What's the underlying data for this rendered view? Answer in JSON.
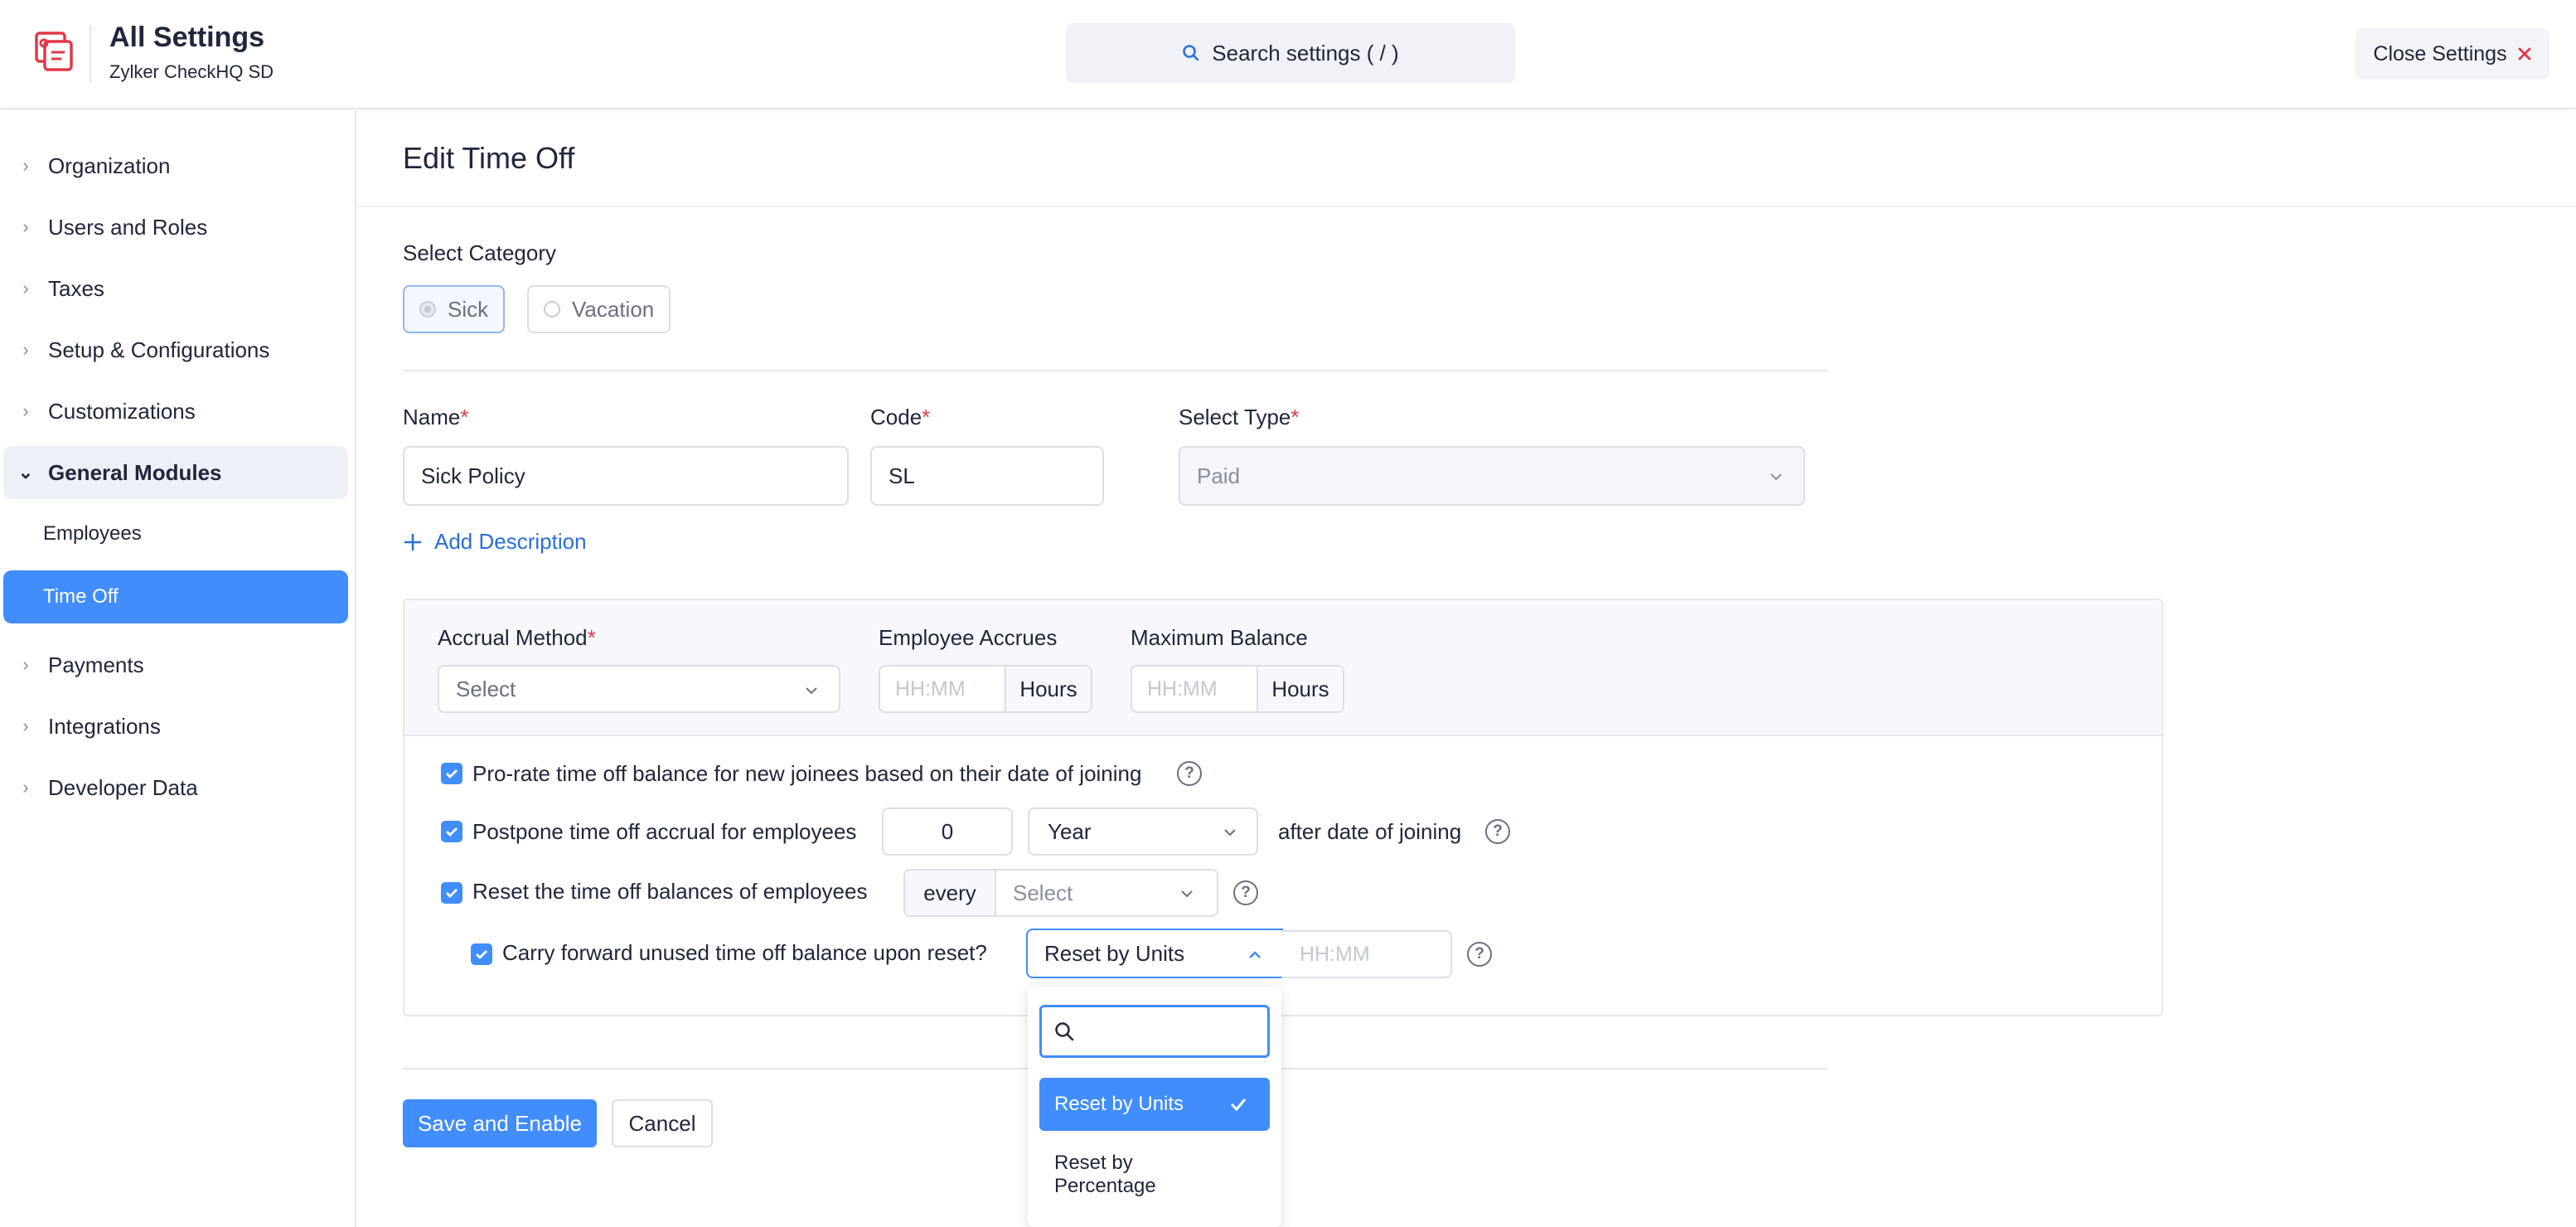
{
  "header": {
    "title": "All Settings",
    "org_name": "Zylker CheckHQ SD",
    "search_label": "Search settings ( / )",
    "close_label": "Close Settings"
  },
  "sidebar": {
    "items": [
      {
        "label": "Organization"
      },
      {
        "label": "Users and Roles"
      },
      {
        "label": "Taxes"
      },
      {
        "label": "Setup & Configurations"
      },
      {
        "label": "Customizations"
      },
      {
        "label": "General Modules",
        "expanded": true
      },
      {
        "label": "Payments"
      },
      {
        "label": "Integrations"
      },
      {
        "label": "Developer Data"
      }
    ],
    "sub_items": [
      {
        "label": "Employees"
      },
      {
        "label": "Time Off",
        "active": true
      }
    ]
  },
  "page": {
    "title": "Edit Time Off",
    "category_label": "Select Category",
    "categories": [
      {
        "label": "Sick",
        "selected": true
      },
      {
        "label": "Vacation",
        "selected": false
      }
    ],
    "name_label": "Name",
    "name_value": "Sick Policy",
    "code_label": "Code",
    "code_value": "SL",
    "type_label": "Select Type",
    "type_value": "Paid",
    "required_mark": "*",
    "add_description": "Add Description"
  },
  "accrual": {
    "method_label": "Accrual Method",
    "method_value": "Select",
    "accrues_label": "Employee Accrues",
    "accrues_placeholder": "HH:MM",
    "accrues_unit": "Hours",
    "max_label": "Maximum Balance",
    "max_placeholder": "HH:MM",
    "max_unit": "Hours"
  },
  "options": {
    "prorate": {
      "label": "Pro-rate time off balance for new joinees based on their date of joining",
      "checked": true
    },
    "postpone": {
      "label": "Postpone time off accrual for employees",
      "checked": true,
      "value": "0",
      "period": "Year",
      "suffix": "after date of joining"
    },
    "reset": {
      "label": "Reset the time off balances of employees",
      "checked": true,
      "every_label": "every",
      "select_value": "Select"
    },
    "carry": {
      "label": "Carry forward unused time off balance upon reset?",
      "checked": true,
      "mode": "Reset by Units",
      "hhmm_placeholder": "HH:MM"
    },
    "help_glyph": "?"
  },
  "dropdown": {
    "search_value": "",
    "options": [
      {
        "label": "Reset by Units",
        "selected": true
      },
      {
        "label": "Reset by Percentage",
        "selected": false
      }
    ]
  },
  "actions": {
    "save_label": "Save and Enable",
    "cancel_label": "Cancel"
  },
  "colors": {
    "accent": "#408dfb",
    "required": "#e0384a",
    "link": "#2b6fd6"
  },
  "icons": {
    "logo": "settings-logo-icon",
    "search": "search-icon",
    "close": "close-icon",
    "chevron": "chevron-right-icon",
    "check": "check-icon",
    "help": "help-circle-icon"
  }
}
